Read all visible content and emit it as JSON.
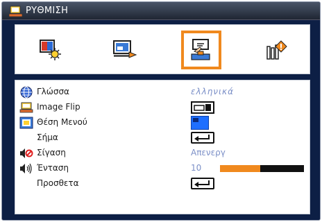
{
  "window": {
    "title": "ΡΥΘΜΙΣΗ",
    "title_icon": "setup-monitor-icon"
  },
  "tabs": [
    {
      "icon": "image-settings-icon",
      "selected": false
    },
    {
      "icon": "display-settings-icon",
      "selected": false
    },
    {
      "icon": "setup-hand-icon",
      "selected": true
    },
    {
      "icon": "options-factory-icon",
      "selected": false
    }
  ],
  "settings": {
    "language": {
      "label": "Γλώσσα",
      "value": "ελληνικά",
      "icon": "language-icon"
    },
    "image_flip": {
      "label": "Image Flip",
      "icon": "image-flip-icon",
      "value_icon": "flip-toggle-icon"
    },
    "menu_position": {
      "label": "Θέση Μενού",
      "icon": "menu-position-icon",
      "value_icon": "menu-position-preview"
    },
    "signal": {
      "label": "Σήμα",
      "value_icon": "enter-icon"
    },
    "mute": {
      "label": "Σίγαση",
      "value": "Απενεργ",
      "icon": "mute-icon"
    },
    "volume": {
      "label": "Ένταση",
      "value": "10",
      "level": 0.48,
      "icon": "volume-icon"
    },
    "advanced": {
      "label": "Προσθετα",
      "value_icon": "enter-icon"
    }
  },
  "colors": {
    "accent": "#f0891e",
    "value_text": "#7b8fc7",
    "background": "#0d1f45"
  }
}
